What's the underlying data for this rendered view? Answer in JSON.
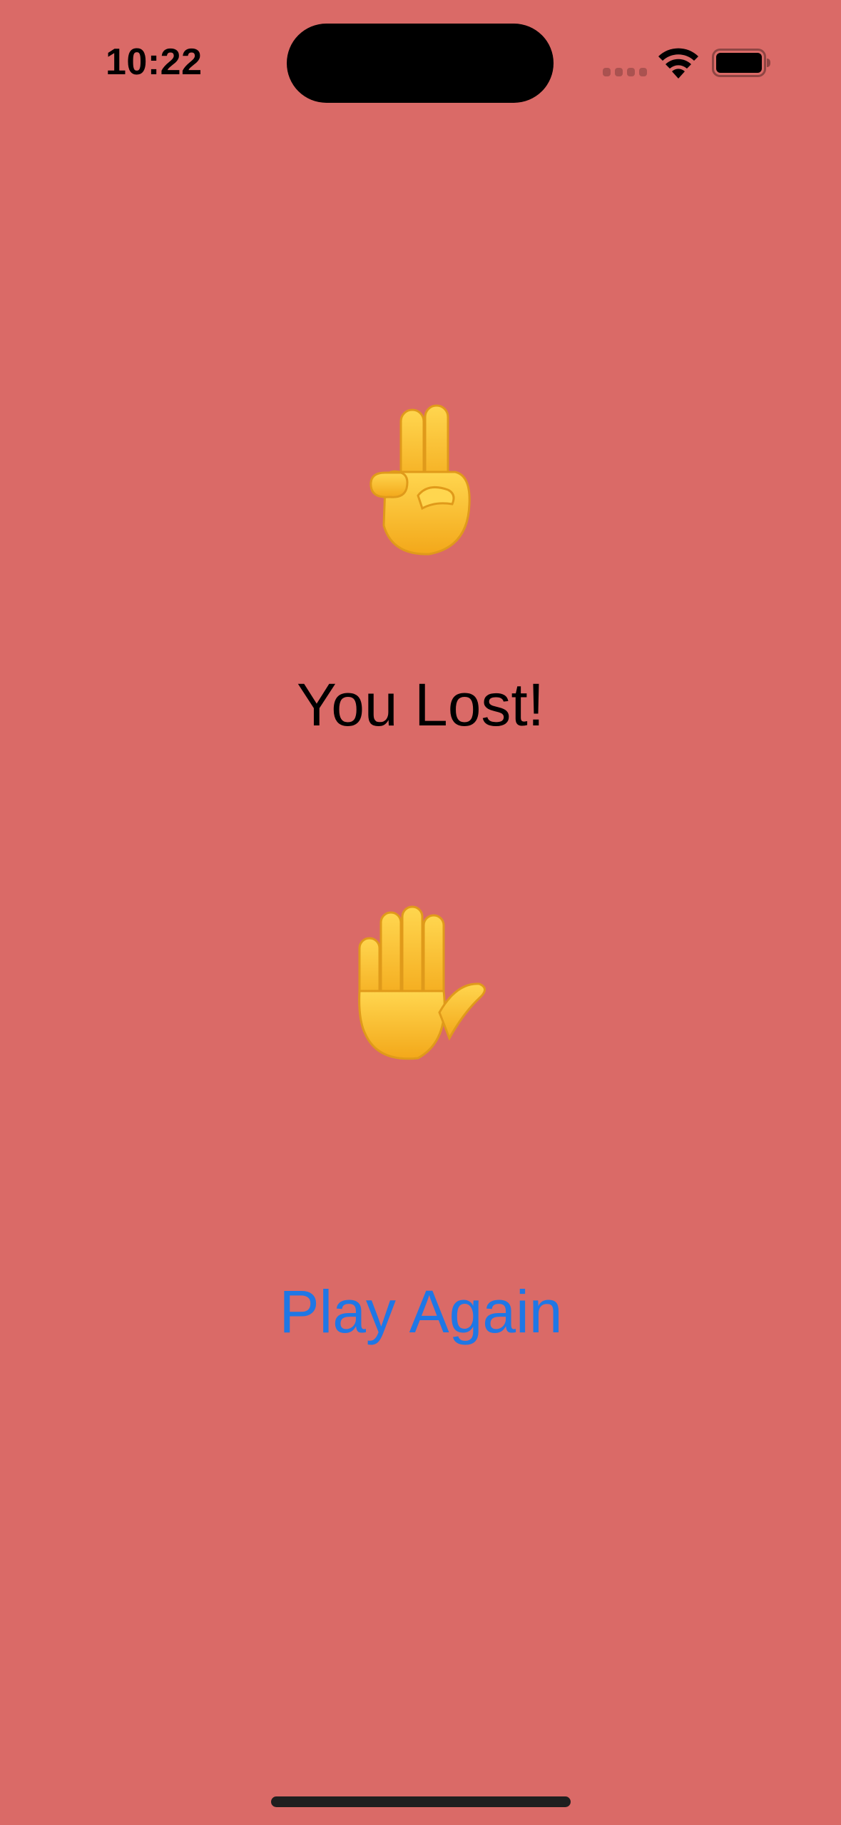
{
  "status_bar": {
    "time": "10:22",
    "icons": [
      "cell-signal-icon",
      "wifi-icon",
      "battery-icon"
    ]
  },
  "game": {
    "opponent_choice_icon": "victory-hand-icon",
    "opponent_choice_glyph": "✌️",
    "result": "You Lost!",
    "player_choice_icon": "raised-hand-icon",
    "player_choice_glyph": "✋",
    "play_again_label": "Play Again"
  },
  "colors": {
    "background": "#DA6A67",
    "button_text": "#1F77E5",
    "result_text": "#000000"
  }
}
